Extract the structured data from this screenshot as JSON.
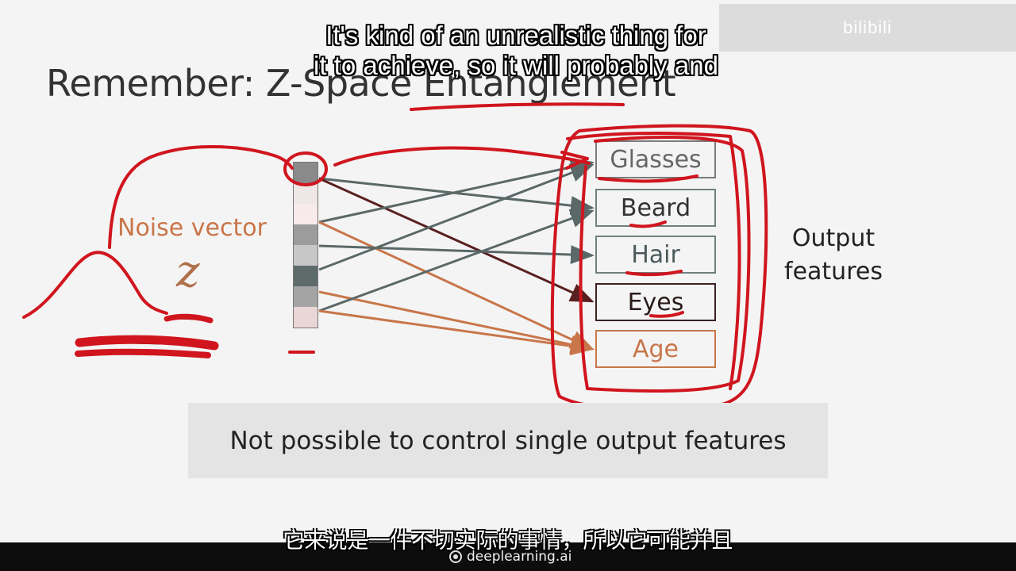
{
  "slide": {
    "title": "Remember: Z-Space Entanglement",
    "noise_label": "Noise vector",
    "z_symbol": "z",
    "vector_cells": [
      "#8a8a8a",
      "#efe6e6",
      "#f6eaea",
      "#9c9c9c",
      "#c7c7c7",
      "#5e6b6b",
      "#a4a4a4",
      "#ead6d6"
    ],
    "features": [
      {
        "label": "Glasses",
        "color": "#666666",
        "border": "#7b7b7b"
      },
      {
        "label": "Beard",
        "color": "#333333",
        "border": "#6f7f7f"
      },
      {
        "label": "Hair",
        "color": "#4a5a5a",
        "border": "#6f7f7f"
      },
      {
        "label": "Eyes",
        "color": "#2a1a1a",
        "border": "#3a2222"
      },
      {
        "label": "Age",
        "color": "#c8764a",
        "border": "#c8764a"
      }
    ],
    "output_label": [
      "Output",
      "features"
    ],
    "banner_text": "Not possible to control single output features"
  },
  "subtitles": {
    "english": [
      "It's kind of an unrealistic thing for",
      "it to achieve, so it will probably and"
    ],
    "chinese": "它来说是一件不切实际的事情，所以它可能并且"
  },
  "watermark": "bilibili",
  "brand": {
    "name": "deeplearning.ai",
    "logo": "deeplearning-logo-icon"
  },
  "colors": {
    "annotation_red": "#d0151e",
    "arrow_dark": "#5a6868",
    "arrow_orange": "#c8764a",
    "arrow_maroon": "#5a2020"
  }
}
